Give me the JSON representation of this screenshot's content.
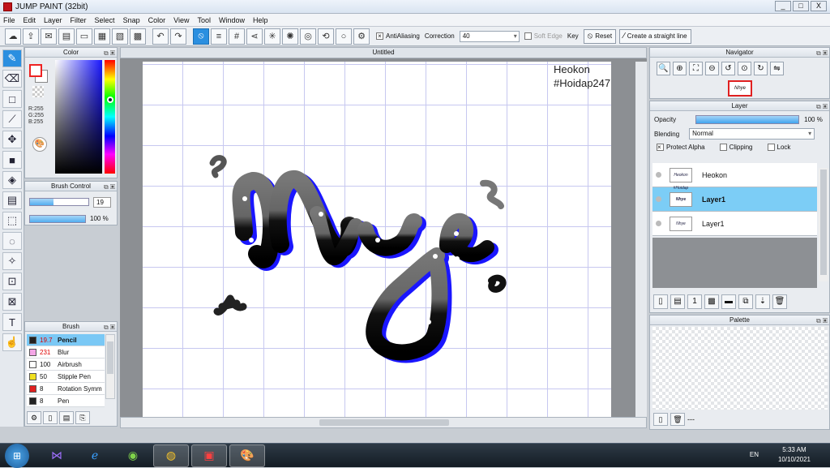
{
  "window": {
    "title": "JUMP PAINT (32bit)",
    "min": "_",
    "max": "□",
    "close": "X"
  },
  "menu": [
    "File",
    "Edit",
    "Layer",
    "Filter",
    "Select",
    "Snap",
    "Color",
    "View",
    "Tool",
    "Window",
    "Help"
  ],
  "toolbar": {
    "antialiasing_label": "AntiAliasing",
    "correction_label": "Correction",
    "correction_value": "40",
    "soft_edge_label": "Soft Edge",
    "key_label": "Key",
    "reset_label": "Reset",
    "straight_line_label": "Create a straight line"
  },
  "color_panel": {
    "title": "Color",
    "r": "R:255",
    "g": "G:255",
    "b": "B:255"
  },
  "brush_control": {
    "title": "Brush Control",
    "size": "19",
    "opacity": "100 %",
    "size_fraction": 0.4,
    "opacity_fraction": 1.0
  },
  "brush_panel": {
    "title": "Brush",
    "items": [
      {
        "size": "19.7",
        "name": "Pencil",
        "color": "#222222"
      },
      {
        "size": "231",
        "name": "Blur",
        "color": "#f4a6e6"
      },
      {
        "size": "100",
        "name": "Airbrush",
        "color": "#ffffff"
      },
      {
        "size": "50",
        "name": "Stipple Pen",
        "color": "#f0e020"
      },
      {
        "size": "8",
        "name": "Rotation Symm",
        "color": "#e02020"
      },
      {
        "size": "8",
        "name": "Pen",
        "color": "#222222"
      }
    ]
  },
  "document": {
    "tab": "Untitled",
    "sig_line1": "Heokon",
    "sig_line2": "#Hoidap247",
    "artwork_text": "Nhye"
  },
  "navigator": {
    "title": "Navigator",
    "thumb": "Nhye"
  },
  "layer_panel": {
    "title": "Layer",
    "opacity_label": "Opacity",
    "opacity_value": "100 %",
    "blending_label": "Blending",
    "blending_value": "Normal",
    "protect_alpha": "Protect Alpha",
    "clipping": "Clipping",
    "lock": "Lock",
    "layers": [
      {
        "name": "Heokon",
        "thumb": "Heokon #Hoidap"
      },
      {
        "name": "Layer1",
        "thumb": "Nhye"
      },
      {
        "name": "Layer1",
        "thumb": "Nhye"
      }
    ]
  },
  "palette_panel": {
    "title": "Palette",
    "footer": "---"
  },
  "taskbar": {
    "lang": "EN",
    "time": "5:33 AM",
    "date": "10/10/2021"
  }
}
